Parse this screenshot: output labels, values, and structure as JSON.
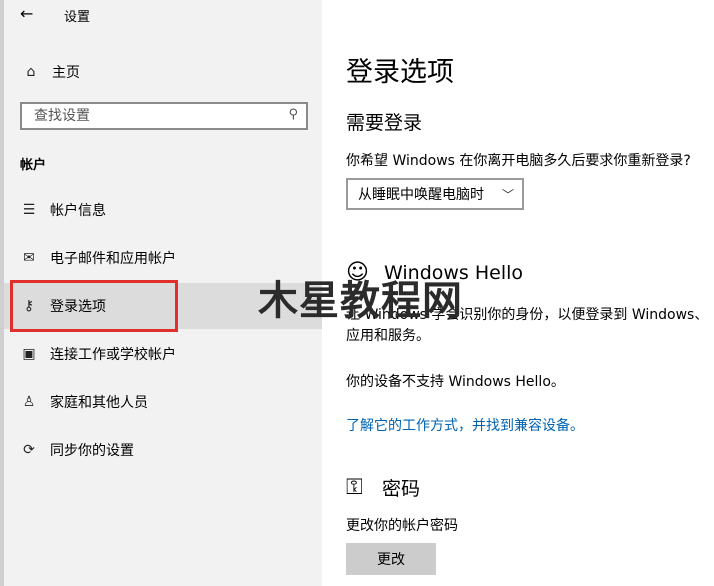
{
  "window": {
    "title": "设置",
    "back_icon": "←"
  },
  "sidebar": {
    "home": {
      "icon": "⌂",
      "label": "主页"
    },
    "search": {
      "placeholder": "查找设置",
      "icon": "⚲"
    },
    "section_title": "帐户",
    "items": [
      {
        "icon": "☰",
        "label": "帐户信息"
      },
      {
        "icon": "✉",
        "label": "电子邮件和应用帐户"
      },
      {
        "icon": "⚷",
        "label": "登录选项",
        "selected": true
      },
      {
        "icon": "▣",
        "label": "连接工作或学校帐户"
      },
      {
        "icon": "♙",
        "label": "家庭和其他人员"
      },
      {
        "icon": "⟳",
        "label": "同步你的设置"
      }
    ],
    "selection_highlight_color": "#e0302e"
  },
  "main": {
    "title": "登录选项",
    "require_signin": {
      "heading": "需要登录",
      "question": "你希望 Windows 在你离开电脑多久后要求你重新登录?",
      "dropdown_value": "从睡眠中唤醒电脑时"
    },
    "hello": {
      "icon": "☺",
      "heading": "Windows Hello",
      "description": "让 Windows 学会识别你的身份，以便登录到 Windows、应用和服务。",
      "not_supported": "你的设备不支持 Windows Hello。",
      "link": "了解它的工作方式，并找到兼容设备。"
    },
    "password": {
      "icon": "⚿",
      "heading": "密码",
      "description": "更改你的帐户密码",
      "button": "更改"
    }
  },
  "watermark": "木星教程网",
  "colors": {
    "link": "#0063b1",
    "sidebar_bg": "#f2f2f2",
    "selected_bg": "#dcdcdc",
    "button_bg": "#cccccc"
  }
}
